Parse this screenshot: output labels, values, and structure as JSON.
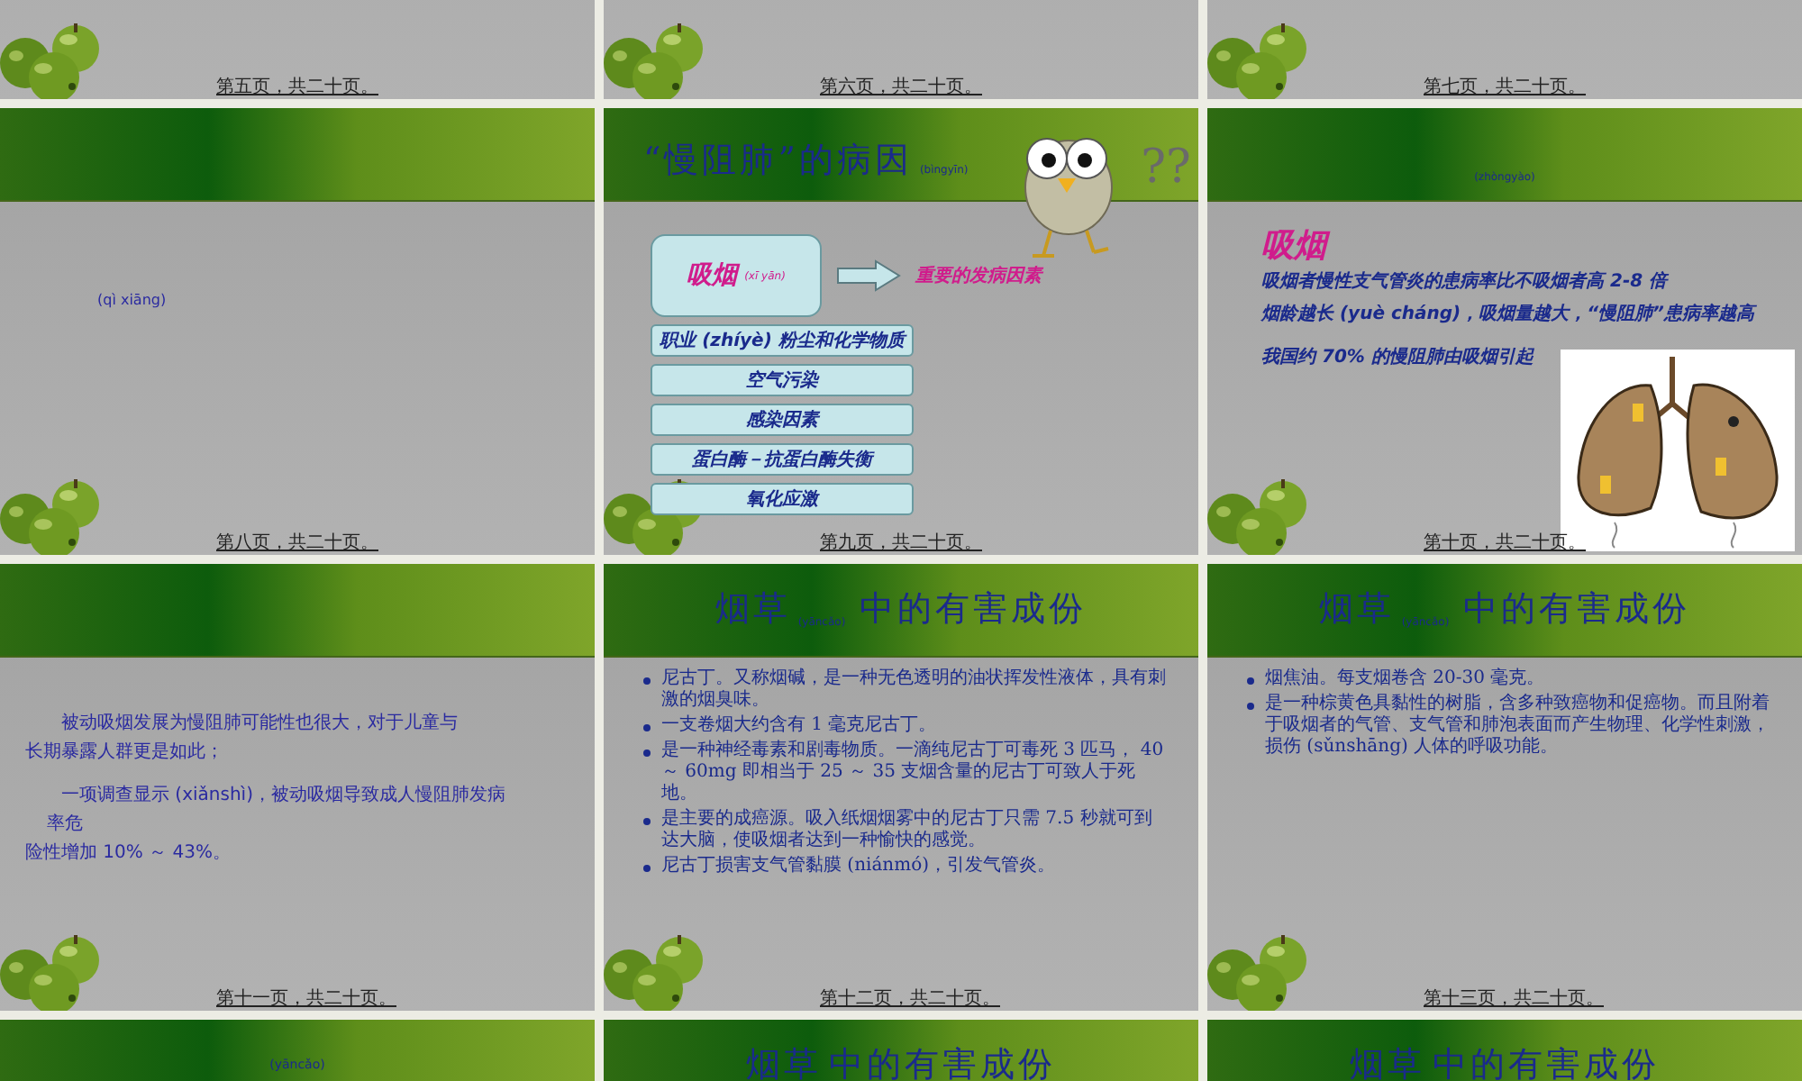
{
  "slides": [
    {
      "kind": "blank",
      "footer": "第五页，共二十页。"
    },
    {
      "kind": "blank",
      "footer": "第六页，共二十页。"
    },
    {
      "kind": "blank",
      "footer": "第七页，共二十页。"
    },
    {
      "kind": "note",
      "body_text": "(qì xiāng)",
      "footer": "第八页，共二十页。"
    },
    {
      "kind": "causes",
      "title": "“慢阻肺”的病因",
      "title_pinyin": "(bìngyīn)",
      "marks": "??",
      "main_cause": "吸烟",
      "main_pinyin": "(xī yān)",
      "main_note": "重要的发病因素",
      "causes": [
        "职业 (zhíyè) 粉尘和化学物质",
        "空气污染",
        "感染因素",
        "蛋白酶－抗蛋白酶失衡",
        "氧化应激"
      ],
      "footer": "第九页，共二十页。"
    },
    {
      "kind": "smoking",
      "header_text": "(zhòngyào)",
      "heading": "吸烟",
      "lines": [
        "吸烟者慢性支气管炎的患病率比不吸烟者高 2-8 倍",
        "烟龄越长 (yuè cháng)，吸烟量越大，“慢阻肺”患病率越高",
        "我国约 70% 的慢阻肺由吸烟引起"
      ],
      "footer": "第十页，共二十页。"
    },
    {
      "kind": "passive",
      "lines": [
        "被动吸烟发展为慢阻肺可能性也很大，对于儿童与",
        "长期暴露人群更是如此；",
        "一项调查显示 (xiǎnshì)，被动吸烟导致成人慢阻肺发病",
        "率危",
        "险性增加 10% ～ 43%。"
      ],
      "footer": "第十一页，共二十页。"
    },
    {
      "kind": "bullets",
      "title": "烟草",
      "title_pinyin": "(yāncǎo)",
      "title_rest": "中的有害成份",
      "bullets": [
        "尼古丁。又称烟碱，是一种无色透明的油状挥发性液体，具有刺激的烟臭味。",
        "一支卷烟大约含有 1 毫克尼古丁。",
        "是一种神经毒素和剧毒物质。一滴纯尼古丁可毒死 3 匹马， 40 ～ 60mg 即相当于 25 ～ 35 支烟含量的尼古丁可致人于死地。",
        "是主要的成癌源。吸入纸烟烟雾中的尼古丁只需 7.5 秒就可到达大脑，使吸烟者达到一种愉快的感觉。",
        "尼古丁损害支气管黏膜 (niánmó)，引发气管炎。"
      ],
      "footer": "第十二页，共二十页。"
    },
    {
      "kind": "bullets",
      "title": "烟草",
      "title_pinyin": "(yāncǎo)",
      "title_rest": "中的有害成份",
      "bullets": [
        "烟焦油。每支烟卷含 20-30 毫克。",
        "是一种棕黄色具黏性的树脂，含多种致癌物和促癌物。而且附着于吸烟者的气管、支气管和肺泡表面而产生物理、化学性刺激，损伤 (sǔnshāng) 人体的呼吸功能。"
      ],
      "footer": "第十三页，共二十页。"
    },
    {
      "kind": "note",
      "header_text": "(yāncǎo)"
    },
    {
      "kind": "bullets",
      "title": "烟草",
      "title_rest": "中的有害成份"
    },
    {
      "kind": "bullets",
      "title": "烟草",
      "title_rest": "中的有害成份"
    }
  ]
}
